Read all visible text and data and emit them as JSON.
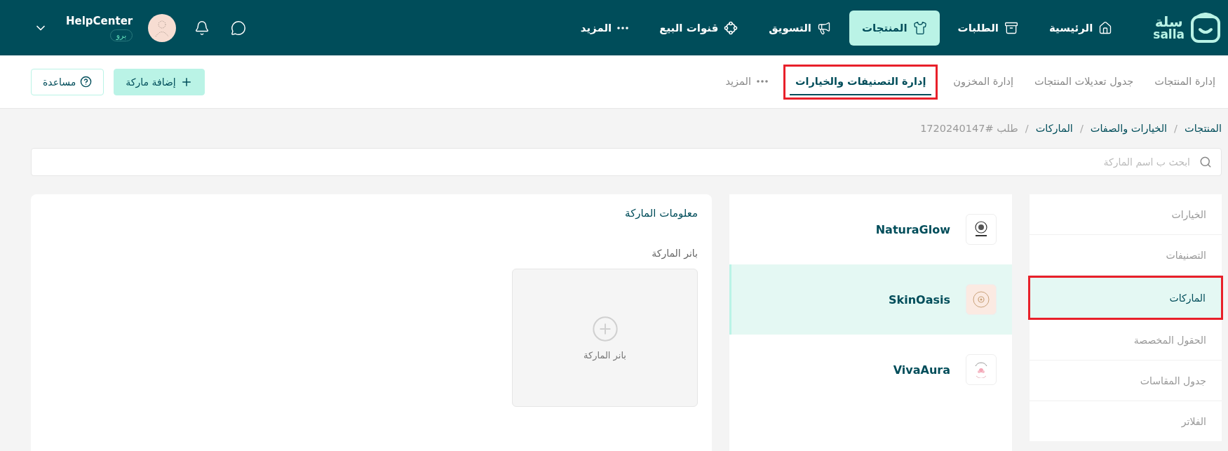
{
  "topbar": {
    "logo": {
      "arabic": "سلة",
      "latin": "salla"
    },
    "nav": [
      {
        "label": "الرئيسية",
        "selected": false
      },
      {
        "label": "الطلبات",
        "selected": false
      },
      {
        "label": "المنتجات",
        "selected": true
      },
      {
        "label": "التسويق",
        "selected": false
      },
      {
        "label": "قنوات البيع",
        "selected": false
      },
      {
        "label": "المزيد",
        "selected": false
      }
    ],
    "user": {
      "name": "HelpCenter",
      "plan": "برو"
    }
  },
  "subnav": {
    "tabs": [
      {
        "label": "إدارة المنتجات",
        "selected": false,
        "highlighted": false
      },
      {
        "label": "جدول تعديلات المنتجات",
        "selected": false,
        "highlighted": false
      },
      {
        "label": "إدارة المخزون",
        "selected": false,
        "highlighted": false
      },
      {
        "label": "إدارة التصنيفات والخيارات",
        "selected": true,
        "highlighted": true
      },
      {
        "label": "المزيد",
        "selected": false,
        "highlighted": false,
        "kind": "more"
      }
    ],
    "buttons": [
      {
        "label": "إضافة ماركة",
        "kind": "primary"
      },
      {
        "label": "مساعدة",
        "kind": "help"
      }
    ]
  },
  "breadcrumb": [
    {
      "label": "المنتجات",
      "current": false
    },
    {
      "separator": "/",
      "label": "الخيارات والصفات",
      "current": false
    },
    {
      "separator": "/",
      "label": "الماركات",
      "current": false
    },
    {
      "separator": "/",
      "label": "طلب #1720240147",
      "current": true
    }
  ],
  "search": {
    "placeholder": "ابحث ب اسم الماركة"
  },
  "sidebar": {
    "items": [
      {
        "label": "الخيارات",
        "selected": false,
        "highlighted": false
      },
      {
        "label": "التصنيفات",
        "selected": false,
        "highlighted": false
      },
      {
        "label": "الماركات",
        "selected": true,
        "highlighted": true
      },
      {
        "label": "الحقول المخصصة",
        "selected": false,
        "highlighted": false
      },
      {
        "label": "جدول المقاسات",
        "selected": false,
        "highlighted": false
      },
      {
        "label": "الفلاتر",
        "selected": false,
        "highlighted": false
      }
    ]
  },
  "brands": [
    {
      "name": "NaturaGlow",
      "selected": false,
      "color": "#ffffff"
    },
    {
      "name": "SkinOasis",
      "selected": true,
      "color": "#fbeae2"
    },
    {
      "name": "VivaAura",
      "selected": false,
      "color": "#ffffff"
    }
  ],
  "brand_info": {
    "title": "معلومات الماركة",
    "banner_label": "بانر الماركة",
    "banner_placeholder": "بانر الماركة"
  }
}
